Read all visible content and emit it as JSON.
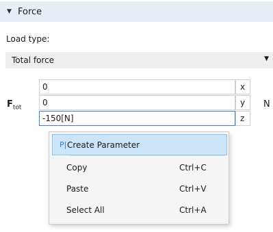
{
  "section": {
    "title": "Force"
  },
  "load_type": {
    "label": "Load type:",
    "value": "Total force"
  },
  "force": {
    "symbol": "F",
    "subscript": "tot",
    "unit": "N",
    "rows": [
      {
        "value": "0",
        "axis": "x"
      },
      {
        "value": "0",
        "axis": "y"
      },
      {
        "value": "-150[N]",
        "axis": "z"
      }
    ]
  },
  "context_menu": {
    "items": [
      {
        "icon": "P|",
        "label": "Create Parameter",
        "shortcut": ""
      },
      {
        "icon": "",
        "label": "Copy",
        "shortcut": "Ctrl+C"
      },
      {
        "icon": "",
        "label": "Paste",
        "shortcut": "Ctrl+V"
      },
      {
        "icon": "",
        "label": "Select All",
        "shortcut": "Ctrl+A"
      }
    ]
  }
}
